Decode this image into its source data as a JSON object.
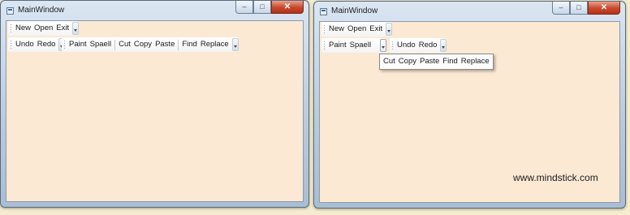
{
  "left_window": {
    "title": "MainWindow",
    "toolbar_top": [
      "New",
      "Open",
      "Exit"
    ],
    "toolbar_second": [
      "Undo",
      "Redo"
    ],
    "toolbar_third": [
      "Paint",
      "Spaell",
      "Cut",
      "Copy",
      "Paste",
      "Find",
      "Replace"
    ]
  },
  "right_window": {
    "title": "MainWindow",
    "toolbar_top": [
      "New",
      "Open",
      "Exit"
    ],
    "toolbar_second": [
      "Paint",
      "Spaell"
    ],
    "toolbar_third": [
      "Undo",
      "Redo"
    ],
    "overflow_popup": [
      "Cut",
      "Copy",
      "Paste",
      "Find",
      "Replace"
    ],
    "watermark": "www.mindstick.com"
  },
  "icons": {
    "window_icon": "app-window-icon",
    "minimize": "minimize-icon",
    "maximize": "maximize-icon",
    "close": "close-icon",
    "overflow": "chevron-down-icon"
  }
}
